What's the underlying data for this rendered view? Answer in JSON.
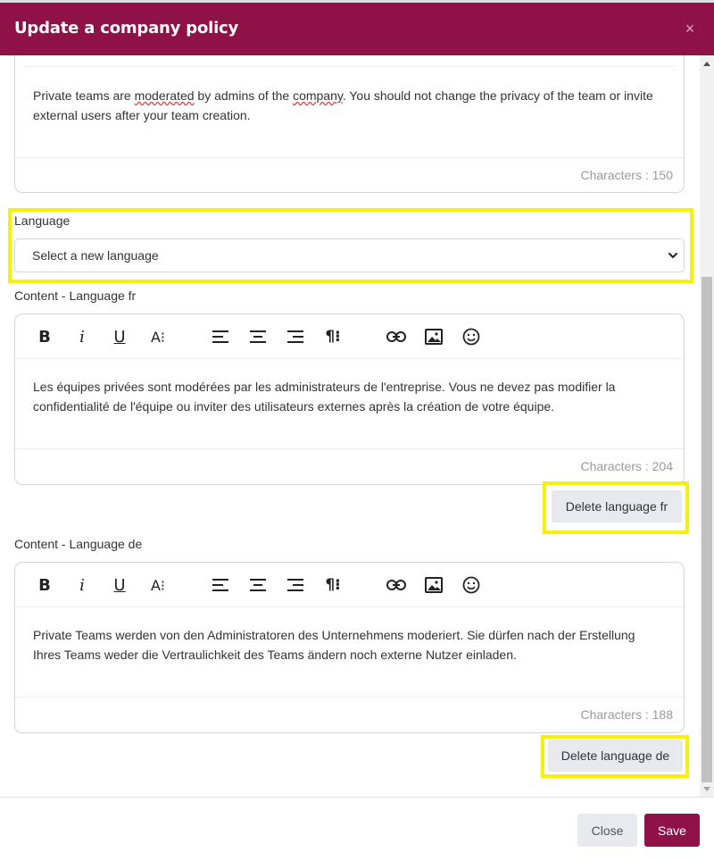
{
  "modal": {
    "title": "Update a company policy",
    "close_symbol": "×"
  },
  "editor_en": {
    "text_part1": "Private teams are ",
    "text_word1": "moderated",
    "text_part2": " by admins of the ",
    "text_word2": "company",
    "text_part3": ". You should not change the privacy of the team or invite external users after your team creation.",
    "characters": "Characters : 150"
  },
  "language": {
    "label": "Language",
    "select_value": "Select a new language"
  },
  "content_fr": {
    "label": "Content - Language fr",
    "text": "Les équipes privées sont modérées par les administrateurs de l'entreprise. Vous ne devez pas modifier la confidentialité de l'équipe ou inviter des utilisateurs externes après la création de votre équipe.",
    "characters": "Characters : 204",
    "delete_label": "Delete language fr"
  },
  "content_de": {
    "label": "Content - Language de",
    "text": "Private Teams werden von den Administratoren des Unternehmens moderiert. Sie dürfen nach der Erstellung Ihres Teams weder die Vertraulichkeit des Teams ändern noch externe Nutzer einladen.",
    "characters": "Characters : 188",
    "delete_label": "Delete language de"
  },
  "toolbar": {
    "bold": "B",
    "italic": "i",
    "underline": "U",
    "font_size": "A⁝",
    "paragraph": "¶⁝",
    "icons": [
      "bold-icon",
      "italic-icon",
      "underline-icon",
      "font-size-icon",
      "align-left-icon",
      "align-center-icon",
      "align-right-icon",
      "paragraph-icon",
      "link-icon",
      "image-icon",
      "emoji-icon"
    ]
  },
  "footer": {
    "close_label": "Close",
    "save_label": "Save"
  },
  "colors": {
    "brand": "#8e1148",
    "highlight": "#f5f00c"
  }
}
